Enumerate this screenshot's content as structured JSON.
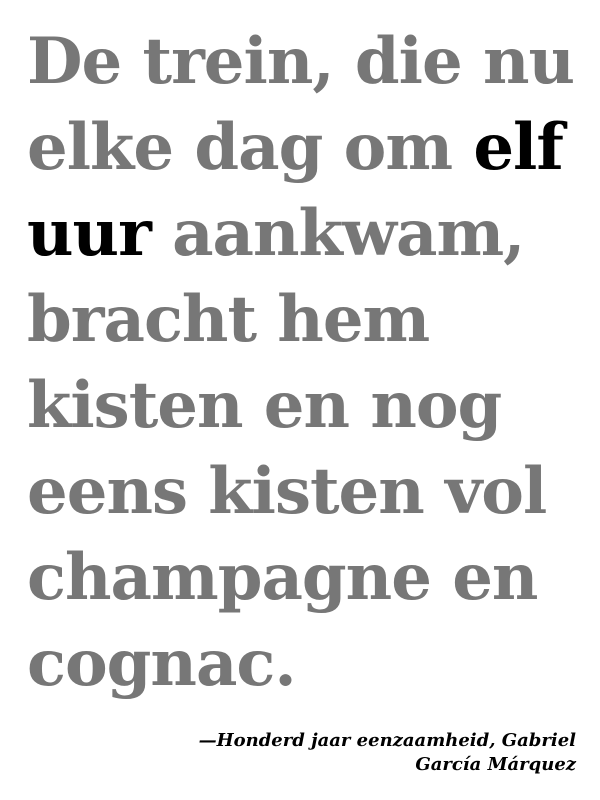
{
  "quote": {
    "line1": "De trein, die nu",
    "line2_before": "elke dag om ",
    "highlight_part1": "elf",
    "highlight_part2": "uur",
    "line3_after": " aankwam,",
    "line4": "bracht hem",
    "line5": "kisten en nog",
    "line6": "eens kisten vol",
    "line7": "champagne en",
    "line8": "cognac."
  },
  "attribution": {
    "line1": "—Honderd jaar eenzaamheid, Gabriel",
    "line2": "García Márquez"
  },
  "colors": {
    "text_dim": "#777777",
    "text_highlight": "#000000",
    "background": "#ffffff"
  }
}
